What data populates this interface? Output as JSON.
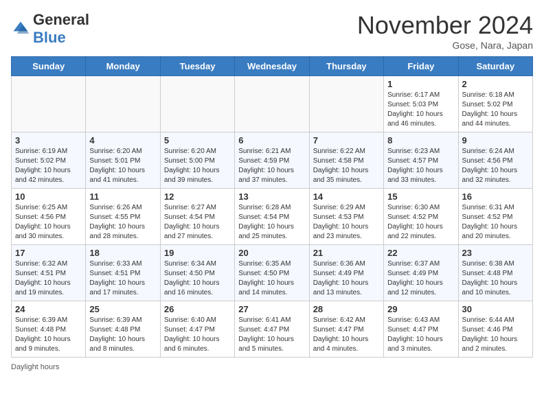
{
  "logo": {
    "general": "General",
    "blue": "Blue"
  },
  "title": "November 2024",
  "location": "Gose, Nara, Japan",
  "days_of_week": [
    "Sunday",
    "Monday",
    "Tuesday",
    "Wednesday",
    "Thursday",
    "Friday",
    "Saturday"
  ],
  "weeks": [
    [
      {
        "day": "",
        "info": ""
      },
      {
        "day": "",
        "info": ""
      },
      {
        "day": "",
        "info": ""
      },
      {
        "day": "",
        "info": ""
      },
      {
        "day": "",
        "info": ""
      },
      {
        "day": "1",
        "info": "Sunrise: 6:17 AM\nSunset: 5:03 PM\nDaylight: 10 hours and 46 minutes."
      },
      {
        "day": "2",
        "info": "Sunrise: 6:18 AM\nSunset: 5:02 PM\nDaylight: 10 hours and 44 minutes."
      }
    ],
    [
      {
        "day": "3",
        "info": "Sunrise: 6:19 AM\nSunset: 5:02 PM\nDaylight: 10 hours and 42 minutes."
      },
      {
        "day": "4",
        "info": "Sunrise: 6:20 AM\nSunset: 5:01 PM\nDaylight: 10 hours and 41 minutes."
      },
      {
        "day": "5",
        "info": "Sunrise: 6:20 AM\nSunset: 5:00 PM\nDaylight: 10 hours and 39 minutes."
      },
      {
        "day": "6",
        "info": "Sunrise: 6:21 AM\nSunset: 4:59 PM\nDaylight: 10 hours and 37 minutes."
      },
      {
        "day": "7",
        "info": "Sunrise: 6:22 AM\nSunset: 4:58 PM\nDaylight: 10 hours and 35 minutes."
      },
      {
        "day": "8",
        "info": "Sunrise: 6:23 AM\nSunset: 4:57 PM\nDaylight: 10 hours and 33 minutes."
      },
      {
        "day": "9",
        "info": "Sunrise: 6:24 AM\nSunset: 4:56 PM\nDaylight: 10 hours and 32 minutes."
      }
    ],
    [
      {
        "day": "10",
        "info": "Sunrise: 6:25 AM\nSunset: 4:56 PM\nDaylight: 10 hours and 30 minutes."
      },
      {
        "day": "11",
        "info": "Sunrise: 6:26 AM\nSunset: 4:55 PM\nDaylight: 10 hours and 28 minutes."
      },
      {
        "day": "12",
        "info": "Sunrise: 6:27 AM\nSunset: 4:54 PM\nDaylight: 10 hours and 27 minutes."
      },
      {
        "day": "13",
        "info": "Sunrise: 6:28 AM\nSunset: 4:54 PM\nDaylight: 10 hours and 25 minutes."
      },
      {
        "day": "14",
        "info": "Sunrise: 6:29 AM\nSunset: 4:53 PM\nDaylight: 10 hours and 23 minutes."
      },
      {
        "day": "15",
        "info": "Sunrise: 6:30 AM\nSunset: 4:52 PM\nDaylight: 10 hours and 22 minutes."
      },
      {
        "day": "16",
        "info": "Sunrise: 6:31 AM\nSunset: 4:52 PM\nDaylight: 10 hours and 20 minutes."
      }
    ],
    [
      {
        "day": "17",
        "info": "Sunrise: 6:32 AM\nSunset: 4:51 PM\nDaylight: 10 hours and 19 minutes."
      },
      {
        "day": "18",
        "info": "Sunrise: 6:33 AM\nSunset: 4:51 PM\nDaylight: 10 hours and 17 minutes."
      },
      {
        "day": "19",
        "info": "Sunrise: 6:34 AM\nSunset: 4:50 PM\nDaylight: 10 hours and 16 minutes."
      },
      {
        "day": "20",
        "info": "Sunrise: 6:35 AM\nSunset: 4:50 PM\nDaylight: 10 hours and 14 minutes."
      },
      {
        "day": "21",
        "info": "Sunrise: 6:36 AM\nSunset: 4:49 PM\nDaylight: 10 hours and 13 minutes."
      },
      {
        "day": "22",
        "info": "Sunrise: 6:37 AM\nSunset: 4:49 PM\nDaylight: 10 hours and 12 minutes."
      },
      {
        "day": "23",
        "info": "Sunrise: 6:38 AM\nSunset: 4:48 PM\nDaylight: 10 hours and 10 minutes."
      }
    ],
    [
      {
        "day": "24",
        "info": "Sunrise: 6:39 AM\nSunset: 4:48 PM\nDaylight: 10 hours and 9 minutes."
      },
      {
        "day": "25",
        "info": "Sunrise: 6:39 AM\nSunset: 4:48 PM\nDaylight: 10 hours and 8 minutes."
      },
      {
        "day": "26",
        "info": "Sunrise: 6:40 AM\nSunset: 4:47 PM\nDaylight: 10 hours and 6 minutes."
      },
      {
        "day": "27",
        "info": "Sunrise: 6:41 AM\nSunset: 4:47 PM\nDaylight: 10 hours and 5 minutes."
      },
      {
        "day": "28",
        "info": "Sunrise: 6:42 AM\nSunset: 4:47 PM\nDaylight: 10 hours and 4 minutes."
      },
      {
        "day": "29",
        "info": "Sunrise: 6:43 AM\nSunset: 4:47 PM\nDaylight: 10 hours and 3 minutes."
      },
      {
        "day": "30",
        "info": "Sunrise: 6:44 AM\nSunset: 4:46 PM\nDaylight: 10 hours and 2 minutes."
      }
    ]
  ],
  "footer": {
    "daylight_label": "Daylight hours"
  }
}
